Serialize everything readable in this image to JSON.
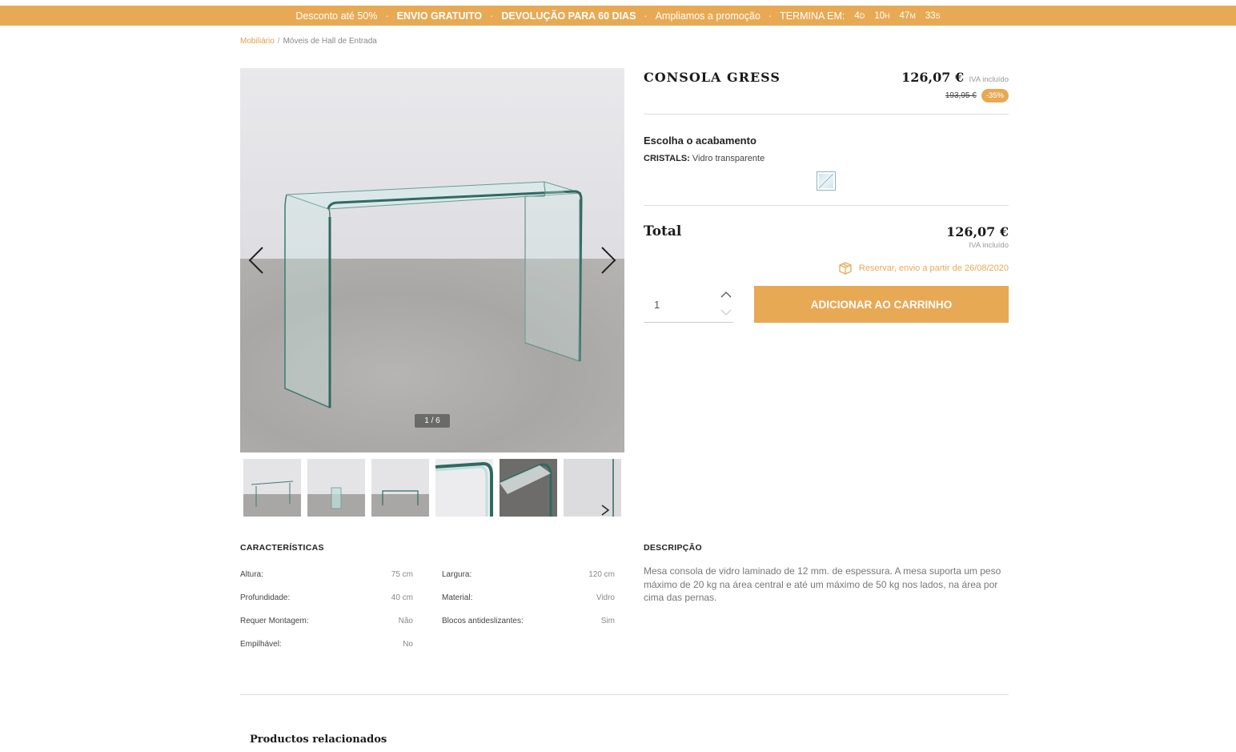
{
  "promo": {
    "discount": "Desconto até 50%",
    "shipping": "ENVIO GRATUITO",
    "returns": "DEVOLUÇÃO PARA 60 DIAS",
    "extended": "Ampliamos a promoção",
    "ends_label": "TERMINA EM:",
    "countdown": {
      "d": "4",
      "d_unit": "D",
      "h": "10",
      "h_unit": "H",
      "m": "47",
      "m_unit": "M",
      "s": "33",
      "s_unit": "S"
    }
  },
  "breadcrumb": {
    "parent": "Mobiliário",
    "current": "Móveis de Hall de Entrada"
  },
  "gallery": {
    "counter": "1 / 6",
    "thumbs": 6
  },
  "product": {
    "title": "CONSOLA GRESS",
    "price": "126,07 €",
    "vat": "IVA incluído",
    "old_price": "193,95 €",
    "discount": "-35%",
    "finish_title": "Escolha o acabamento",
    "finish_label": "CRISTALS:",
    "finish_value": "Vidro transparente",
    "total_label": "Total",
    "total_amount": "126,07 €",
    "total_vat": "IVA incluído",
    "reserve": "Reservar, envio a partir de 26/08/2020",
    "quantity": "1",
    "add_to_cart": "ADICIONAR AO CARRINHO"
  },
  "characteristics": {
    "title": "CARACTERÍSTICAS",
    "left": [
      {
        "label": "Altura:",
        "value": "75 cm"
      },
      {
        "label": "Profundidade:",
        "value": "40 cm"
      },
      {
        "label": "Requer Montagem:",
        "value": "Não"
      },
      {
        "label": "Empilhável:",
        "value": "No"
      }
    ],
    "right": [
      {
        "label": "Largura:",
        "value": "120 cm"
      },
      {
        "label": "Material:",
        "value": "Vidro"
      },
      {
        "label": "Blocos antideslizantes:",
        "value": "Sim"
      }
    ]
  },
  "description": {
    "title": "DESCRIPÇÃO",
    "text": "Mesa consola de vidro laminado de 12 mm. de espessura. A mesa suporta um peso máximo de 20 kg na área central e até um máximo de 50 kg nos lados, na área por cima das pernas."
  },
  "related": {
    "title": "Productos relacionados"
  },
  "colors": {
    "accent": "#e8a955",
    "text": "#222222"
  }
}
